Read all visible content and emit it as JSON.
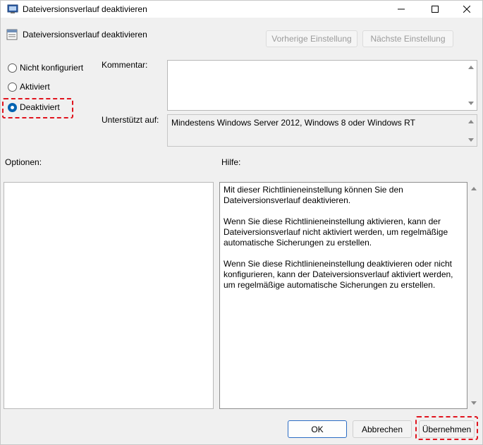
{
  "window": {
    "title": "Dateiversionsverlauf deaktivieren",
    "controls": [
      "minimize-icon",
      "maximize-icon",
      "close-icon"
    ]
  },
  "header": {
    "policy_title": "Dateiversionsverlauf deaktivieren",
    "prev_button": "Vorherige Einstellung",
    "next_button": "Nächste Einstellung"
  },
  "state": {
    "options": [
      {
        "label": "Nicht konfiguriert",
        "checked": false
      },
      {
        "label": "Aktiviert",
        "checked": false
      },
      {
        "label": "Deaktiviert",
        "checked": true
      }
    ]
  },
  "comment": {
    "label": "Kommentar:",
    "value": ""
  },
  "supported": {
    "label": "Unterstützt auf:",
    "value": "Mindestens Windows Server 2012, Windows 8 oder Windows RT"
  },
  "options_panel": {
    "label": "Optionen:"
  },
  "help_panel": {
    "label": "Hilfe:",
    "text": "Mit dieser Richtlinieneinstellung können Sie den Dateiversionsverlauf deaktivieren.\n\nWenn Sie diese Richtlinieneinstellung aktivieren, kann der Dateiversionsverlauf nicht aktiviert werden, um regelmäßige automatische Sicherungen zu erstellen.\n\nWenn Sie diese Richtlinieneinstellung deaktivieren oder nicht konfigurieren, kann der Dateiversionsverlauf aktiviert werden, um regelmäßige automatische Sicherungen zu erstellen."
  },
  "footer": {
    "ok": "OK",
    "cancel": "Abbrechen",
    "apply": "Übernehmen"
  },
  "colors": {
    "highlight": "#e0141e",
    "accent": "#0063b1"
  }
}
